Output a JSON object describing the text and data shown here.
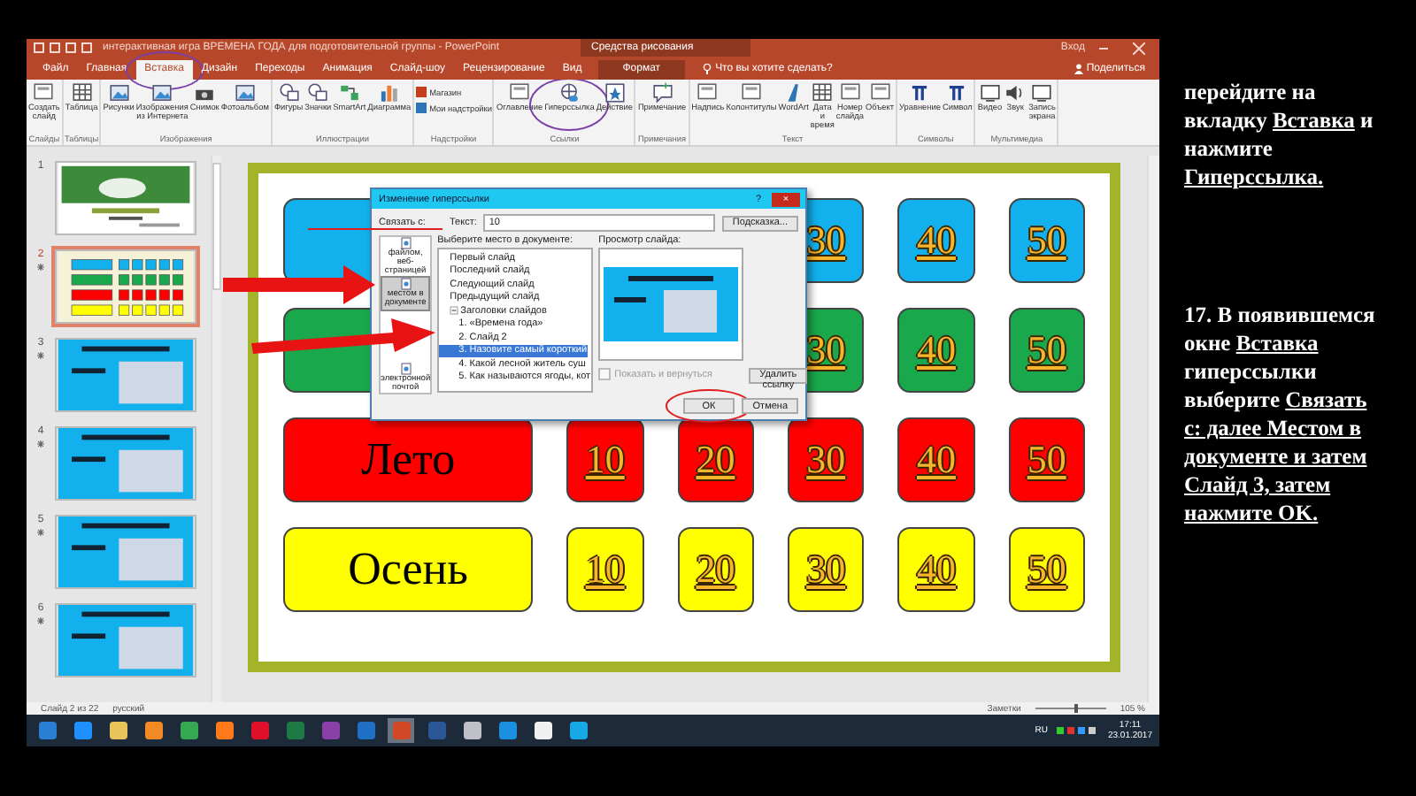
{
  "title_bar": {
    "title": "интерактивная игра ВРЕМЕНА ГОДА для подготовительной группы - PowerPoint",
    "context_tab": "Средства рисования",
    "sign_in": "Вход"
  },
  "tabs": [
    {
      "label": "Файл",
      "selected": false,
      "kind": "normal",
      "circled": false
    },
    {
      "label": "Главная",
      "selected": false,
      "kind": "normal",
      "circled": false
    },
    {
      "label": "Вставка",
      "selected": true,
      "kind": "normal",
      "circled": true
    },
    {
      "label": "Дизайн",
      "selected": false,
      "kind": "normal",
      "circled": false
    },
    {
      "label": "Переходы",
      "selected": false,
      "kind": "normal",
      "circled": false
    },
    {
      "label": "Анимация",
      "selected": false,
      "kind": "normal",
      "circled": false
    },
    {
      "label": "Слайд-шоу",
      "selected": false,
      "kind": "normal",
      "circled": false
    },
    {
      "label": "Рецензирование",
      "selected": false,
      "kind": "normal",
      "circled": false
    },
    {
      "label": "Вид",
      "selected": false,
      "kind": "normal",
      "circled": false
    },
    {
      "label": "Формат",
      "selected": false,
      "kind": "context",
      "circled": false
    }
  ],
  "tell_me": "Что вы хотите сделать?",
  "share": "Поделиться",
  "ribbon": [
    {
      "label": "Слайды",
      "buttons": [
        {
          "label": "Создать слайд",
          "kind": "slide",
          "circled": false
        }
      ]
    },
    {
      "label": "Таблицы",
      "buttons": [
        {
          "label": "Таблица",
          "kind": "table",
          "circled": false
        }
      ]
    },
    {
      "label": "Изображения",
      "buttons": [
        {
          "label": "Рисунки",
          "kind": "picture",
          "circled": false
        },
        {
          "label": "Изображения из Интернета",
          "kind": "picture",
          "circled": false
        },
        {
          "label": "Снимок",
          "kind": "camera",
          "circled": false
        },
        {
          "label": "Фотоальбом",
          "kind": "picture",
          "circled": false
        }
      ]
    },
    {
      "label": "Иллюстрации",
      "buttons": [
        {
          "label": "Фигуры",
          "kind": "shapes",
          "circled": false
        },
        {
          "label": "Значки",
          "kind": "shapes",
          "circled": false
        },
        {
          "label": "SmartArt",
          "kind": "smartart",
          "circled": false
        },
        {
          "label": "Диаграмма",
          "kind": "chart",
          "circled": false
        }
      ]
    },
    {
      "label": "Надстройки",
      "buttons": [
        {
          "label": "Магазин",
          "kind": "small",
          "circled": false
        },
        {
          "label": "Мои надстройки",
          "kind": "small",
          "circled": false
        }
      ]
    },
    {
      "label": "Ссылки",
      "buttons": [
        {
          "label": "Оглавление",
          "kind": "slide",
          "circled": false
        },
        {
          "label": "Гиперссылка",
          "kind": "link",
          "circled": true
        },
        {
          "label": "Действие",
          "kind": "star",
          "circled": false
        }
      ]
    },
    {
      "label": "Примечания",
      "buttons": [
        {
          "label": "Примечание",
          "kind": "comment",
          "circled": false
        }
      ]
    },
    {
      "label": "Текст",
      "buttons": [
        {
          "label": "Надпись",
          "kind": "slide",
          "circled": false
        },
        {
          "label": "Колонтитулы",
          "kind": "slide",
          "circled": false
        },
        {
          "label": "WordArt",
          "kind": "wordart",
          "circled": false
        },
        {
          "label": "Дата и время",
          "kind": "table",
          "circled": false
        },
        {
          "label": "Номер слайда",
          "kind": "slide",
          "circled": false
        },
        {
          "label": "Объект",
          "kind": "slide",
          "circled": false
        }
      ]
    },
    {
      "label": "Символы",
      "buttons": [
        {
          "label": "Уравнение",
          "kind": "symbol",
          "circled": false
        },
        {
          "label": "Символ",
          "kind": "symbol",
          "circled": false
        }
      ]
    },
    {
      "label": "Мультимедиа",
      "buttons": [
        {
          "label": "Видео",
          "kind": "video",
          "circled": false
        },
        {
          "label": "Звук",
          "kind": "sound",
          "circled": false
        },
        {
          "label": "Запись экрана",
          "kind": "video",
          "circled": false
        }
      ]
    }
  ],
  "thumbnails": [
    {
      "number": "1",
      "kind": "title",
      "selected": false,
      "animated": false
    },
    {
      "number": "2",
      "kind": "grid",
      "selected": true,
      "animated": true
    },
    {
      "number": "3",
      "kind": "question",
      "selected": false,
      "animated": true
    },
    {
      "number": "4",
      "kind": "question",
      "selected": false,
      "animated": true
    },
    {
      "number": "5",
      "kind": "question",
      "selected": false,
      "animated": true
    },
    {
      "number": "6",
      "kind": "question",
      "selected": false,
      "animated": true
    }
  ],
  "slide": {
    "rows": [
      {
        "color": "#12b0ec",
        "tiles": [
          {
            "value": "30"
          },
          {
            "value": "40"
          },
          {
            "value": "50"
          }
        ]
      },
      {
        "color": "#1aa84c",
        "tiles": [
          {
            "value": "30"
          },
          {
            "value": "40"
          },
          {
            "value": "50"
          }
        ]
      },
      {
        "color": "#ff0000",
        "label": "Лето",
        "tiles": [
          {
            "value": "10"
          },
          {
            "value": "20"
          },
          {
            "value": "30"
          },
          {
            "value": "40"
          },
          {
            "value": "50"
          }
        ]
      },
      {
        "color": "#ffff00",
        "label": "Осень",
        "tiles": [
          {
            "value": "10"
          },
          {
            "value": "20"
          },
          {
            "value": "30"
          },
          {
            "value": "40"
          },
          {
            "value": "50"
          }
        ]
      }
    ]
  },
  "dialog": {
    "title": "Изменение гиперссылки",
    "help": "?",
    "close": "×",
    "link_to": "Связать с:",
    "text_label": "Текст:",
    "text_value": "10",
    "tip_button": "Подсказка...",
    "nav": [
      {
        "label": "файлом, веб-страницей",
        "selected": false
      },
      {
        "label": "местом в документе",
        "selected": true
      },
      {
        "label": "электронной почтой",
        "selected": false
      }
    ],
    "place_label": "Выберите место в документе:",
    "tree": [
      {
        "label": "Первый слайд",
        "selected": false
      },
      {
        "label": "Последний слайд",
        "selected": false
      },
      {
        "label": "Следующий слайд",
        "selected": false
      },
      {
        "label": "Предыдущий слайд",
        "selected": false
      },
      {
        "label": "Заголовки слайдов",
        "selected": false,
        "expanded": true,
        "children": [
          {
            "label": "1. «Времена года»",
            "selected": false
          },
          {
            "label": "2. Слайд 2",
            "selected": false
          },
          {
            "label": "3. Назовите самый короткий",
            "selected": true
          },
          {
            "label": "4. Какой лесной житель суш",
            "selected": false
          },
          {
            "label": "5. Как называются ягоды, кот",
            "selected": false
          }
        ]
      }
    ],
    "preview_label": "Просмотр слайда:",
    "show_return": {
      "label": "Показать и вернуться",
      "checked": false,
      "disabled": true
    },
    "remove_button": "Удалить ссылку",
    "ok_button": {
      "label": "ОК",
      "circled": true
    },
    "cancel_button": "Отмена"
  },
  "status_bar": {
    "slide": "Слайд 2 из 22",
    "language": "русский",
    "notes": "Заметки",
    "zoom": "105 %",
    "level": 0.55
  },
  "taskbar": {
    "apps": [
      {
        "color": "#2a7fd4",
        "selected": false
      },
      {
        "color": "#1e90ff",
        "selected": false
      },
      {
        "color": "#e8c35a",
        "selected": false
      },
      {
        "color": "#f08a24",
        "selected": false
      },
      {
        "color": "#36a852",
        "selected": false
      },
      {
        "color": "#ff7a1a",
        "selected": false
      },
      {
        "color": "#e0102a",
        "selected": false
      },
      {
        "color": "#1d7a45",
        "selected": false
      },
      {
        "color": "#8b3fa8",
        "selected": false
      },
      {
        "color": "#1f6fc4",
        "selected": false
      },
      {
        "color": "#d24726",
        "selected": true
      },
      {
        "color": "#2b5797",
        "selected": false
      },
      {
        "color": "#c0c0c8",
        "selected": false
      },
      {
        "color": "#1a8fe0",
        "selected": false
      },
      {
        "color": "#f0f0f0",
        "selected": false
      },
      {
        "color": "#17a9e6",
        "selected": false
      }
    ],
    "language": "RU",
    "time": "17:11",
    "date": "23.01.2017"
  },
  "instructions": [
    {
      "segments": [
        {
          "text": "перейдите на вкладку ",
          "underline": false
        },
        {
          "text": "Вставка",
          "underline": true
        },
        {
          "text": " и нажмите ",
          "underline": false
        },
        {
          "text": "Гиперссылка.",
          "underline": true
        }
      ]
    },
    {
      "segments": [
        {
          "text": "17. В появившемся окне ",
          "underline": false
        },
        {
          "text": "Вставка",
          "underline": true
        },
        {
          "text": " гиперссылки выберите ",
          "underline": false
        },
        {
          "text": "Связать с: далее Местом в документе и затем Слайд 3, затем нажмите OK.",
          "underline": true
        }
      ]
    }
  ]
}
